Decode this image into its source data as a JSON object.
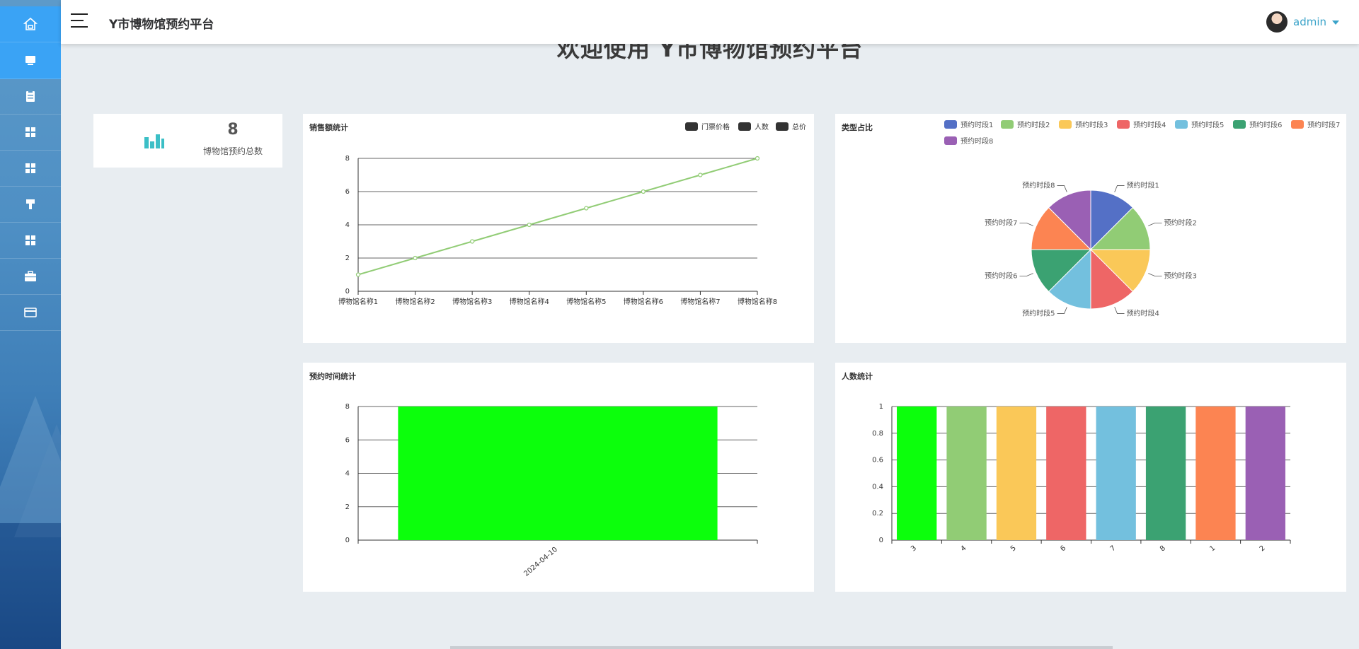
{
  "app": {
    "title": "Y市博物馆预约平台",
    "welcome": "欢迎使用 Y市博物馆预约平台"
  },
  "user": {
    "name": "admin"
  },
  "sidebar": {
    "items": [
      {
        "icon": "home-icon"
      },
      {
        "icon": "monitor-icon"
      },
      {
        "icon": "clipboard-icon"
      },
      {
        "icon": "grid-icon"
      },
      {
        "icon": "grid-icon"
      },
      {
        "icon": "brush-icon"
      },
      {
        "icon": "grid-icon"
      },
      {
        "icon": "briefcase-icon"
      },
      {
        "icon": "card-icon"
      }
    ]
  },
  "stat": {
    "value": "8",
    "label": "博物馆预约总数",
    "color": "#3bbfc6"
  },
  "panels": {
    "sales": {
      "title": "销售额统计",
      "legend": [
        "门票价格",
        "人数",
        "总价"
      ]
    },
    "type": {
      "title": "类型占比"
    },
    "time": {
      "title": "预约时间统计"
    },
    "people": {
      "title": "人数统计"
    }
  },
  "chart_data": [
    {
      "type": "line",
      "title": "销售额统计",
      "categories": [
        "博物馆名称1",
        "博物馆名称2",
        "博物馆名称3",
        "博物馆名称4",
        "博物馆名称5",
        "博物馆名称6",
        "博物馆名称7",
        "博物馆名称8"
      ],
      "series": [
        {
          "name": "门票价格",
          "values": [
            1,
            2,
            3,
            4,
            5,
            6,
            7,
            8
          ],
          "color": "#91cc75"
        }
      ],
      "legend": [
        "门票价格",
        "人数",
        "总价"
      ],
      "ylim": [
        0,
        8
      ],
      "yticks": [
        0,
        2,
        4,
        6,
        8
      ],
      "grid": true,
      "legend_position": "top-right"
    },
    {
      "type": "pie",
      "title": "类型占比",
      "labels": [
        "预约时段1",
        "预约时段2",
        "预约时段3",
        "预约时段4",
        "预约时段5",
        "预约时段6",
        "预约时段7",
        "预约时段8"
      ],
      "values": [
        1,
        1,
        1,
        1,
        1,
        1,
        1,
        1
      ],
      "colors": [
        "#5470c6",
        "#91cc75",
        "#fac858",
        "#ee6666",
        "#73c0de",
        "#3ba272",
        "#fc8452",
        "#9a60b4"
      ],
      "legend_position": "top"
    },
    {
      "type": "bar",
      "title": "预约时间统计",
      "categories": [
        "2024-04-10"
      ],
      "values": [
        8
      ],
      "color": "#0cff0c",
      "ylim": [
        0,
        8
      ],
      "yticks": [
        0,
        2,
        4,
        6,
        8
      ],
      "grid": true
    },
    {
      "type": "bar",
      "title": "人数统计",
      "categories": [
        "3",
        "4",
        "5",
        "6",
        "7",
        "8",
        "1",
        "2"
      ],
      "values": [
        1,
        1,
        1,
        1,
        1,
        1,
        1,
        1
      ],
      "colors": [
        "#0cff0c",
        "#91cc75",
        "#fac858",
        "#ee6666",
        "#73c0de",
        "#3ba272",
        "#fc8452",
        "#9a60b4"
      ],
      "ylim": [
        0,
        1
      ],
      "yticks": [
        0,
        0.2,
        0.4,
        0.6,
        0.8,
        1
      ],
      "grid": true
    }
  ]
}
